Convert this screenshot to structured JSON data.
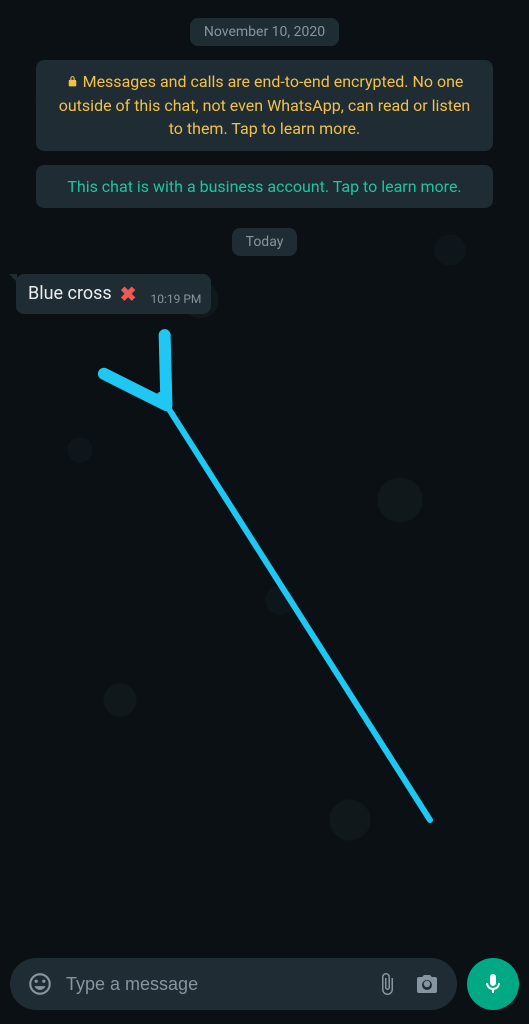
{
  "chat": {
    "date_label": "November 10, 2020",
    "encryption_notice": "Messages and calls are end-to-end encrypted. No one outside of this chat, not even WhatsApp, can read or listen to them. Tap to learn more.",
    "business_notice": "This chat is with a business account. Tap to learn more.",
    "today_label": "Today",
    "messages": [
      {
        "text": "Blue cross",
        "emoji": "✖",
        "time": "10:19 PM"
      }
    ]
  },
  "composer": {
    "placeholder": "Type a message"
  },
  "colors": {
    "accent": "#00a884",
    "bg": "#0d1418",
    "bubble": "#1f2c33",
    "warn": "#f2c14a",
    "teal": "#1cc6a0",
    "arrow": "#1ec8f2"
  }
}
